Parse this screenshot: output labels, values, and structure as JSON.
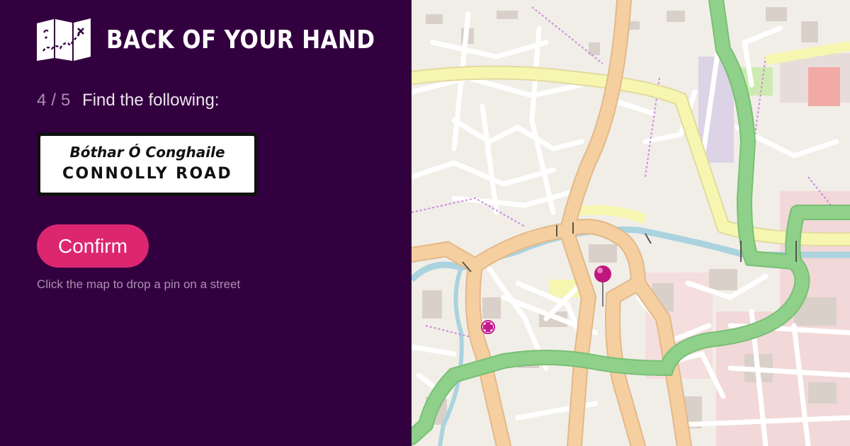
{
  "app": {
    "title": "BACK OF YOUR HAND",
    "logo_icon": "treasure-map-icon"
  },
  "quiz": {
    "progress_current": "4",
    "progress_separator": "/",
    "progress_total": "5",
    "prompt": "Find the following:"
  },
  "street_sign": {
    "irish_name": "Bóthar Ó Conghaile",
    "english_name": "CONNOLLY ROAD"
  },
  "actions": {
    "confirm_label": "Confirm"
  },
  "hint": "Click the map to drop a pin on a street",
  "map": {
    "pin_icon": "map-pin-icon",
    "pharmacy_icon": "pharmacy-cross-icon"
  },
  "colors": {
    "background": "#33003f",
    "accent": "#dd2670",
    "muted_text": "#a98fb1",
    "map_primary_road": "#f5cf9f",
    "map_trunk_road": "#8fd18a",
    "map_secondary_road": "#f6f6b0",
    "map_river": "#aad3df",
    "map_path": "#cc88dd"
  }
}
